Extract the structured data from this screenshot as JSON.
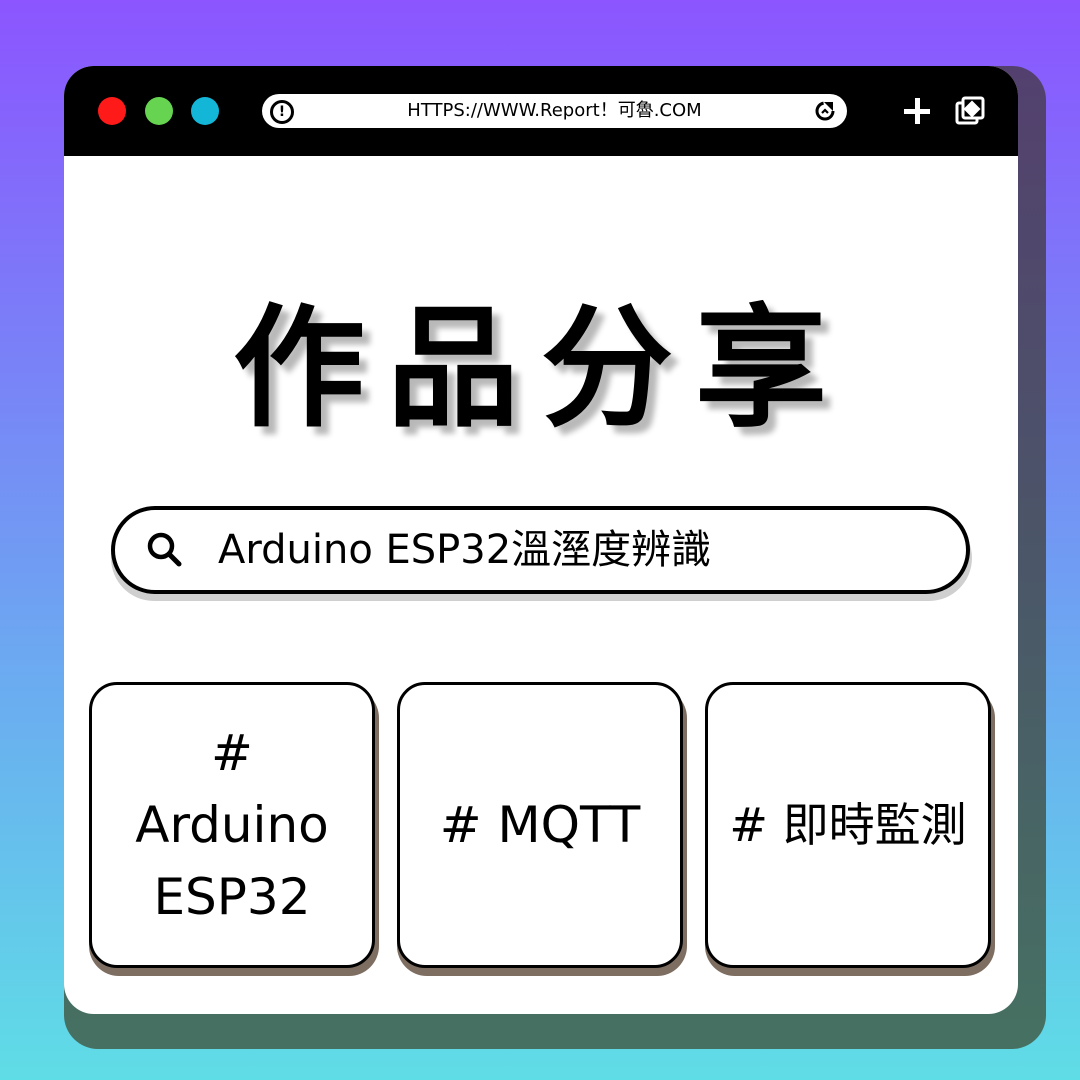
{
  "browser": {
    "url": "HTTPS://WWW.Report！可魯.COM",
    "window_controls": [
      "red",
      "green",
      "cyan"
    ],
    "icons": {
      "address_left": "alert-circle-icon",
      "address_right": "refresh-icon",
      "new_tab": "plus-icon",
      "tabs": "tabs-icon"
    }
  },
  "headline": "作品分享",
  "search": {
    "value": "Arduino ESP32溫溼度辨識",
    "icon": "search-icon"
  },
  "tags": [
    {
      "label": "# Arduino ESP32"
    },
    {
      "label": "# MQTT"
    },
    {
      "label": "# 即時監測"
    }
  ],
  "colors": {
    "background_top": "#8c55ff",
    "background_bottom": "#5fdde6",
    "titlebar": "#000000",
    "dot_red": "#ff1a1a",
    "dot_green": "#66d450",
    "dot_cyan": "#14b6d8",
    "card_shadow": "#7d6e61"
  }
}
